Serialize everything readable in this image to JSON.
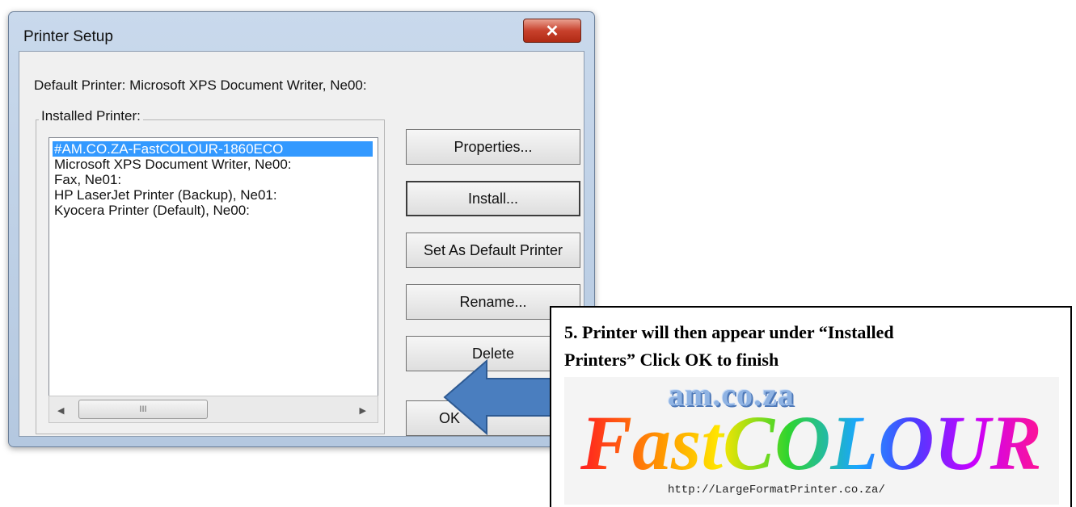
{
  "window": {
    "title": "Printer Setup",
    "close_label": "✕"
  },
  "default_printer_label": "Default Printer: Microsoft XPS Document Writer, Ne00:",
  "installed": {
    "legend": "Installed Printer:",
    "items": [
      {
        "label": "#AM.CO.ZA-FastCOLOUR-1860ECO",
        "selected": true
      },
      {
        "label": "Microsoft XPS Document Writer, Ne00:",
        "selected": false
      },
      {
        "label": "Fax, Ne01:",
        "selected": false
      },
      {
        "label": "HP LaserJet Printer (Backup), Ne01:",
        "selected": false
      },
      {
        "label": "Kyocera Printer (Default), Ne00:",
        "selected": false
      }
    ],
    "scrollbar_grip": "III"
  },
  "buttons": {
    "properties": "Properties...",
    "install": "Install...",
    "set_default": "Set As Default Printer",
    "rename": "Rename...",
    "delete": "Delete",
    "ok": "OK"
  },
  "callout": {
    "line1": "5. Printer will then appear under “Installed",
    "line2": "Printers” Click OK to finish",
    "logo_top": "am.co.za",
    "logo_main": "FastCOLOUR",
    "logo_url": "http://LargeFormatPrinter.co.za/"
  },
  "colors": {
    "selection": "#3399ff",
    "arrow": "#4a7ebf"
  }
}
